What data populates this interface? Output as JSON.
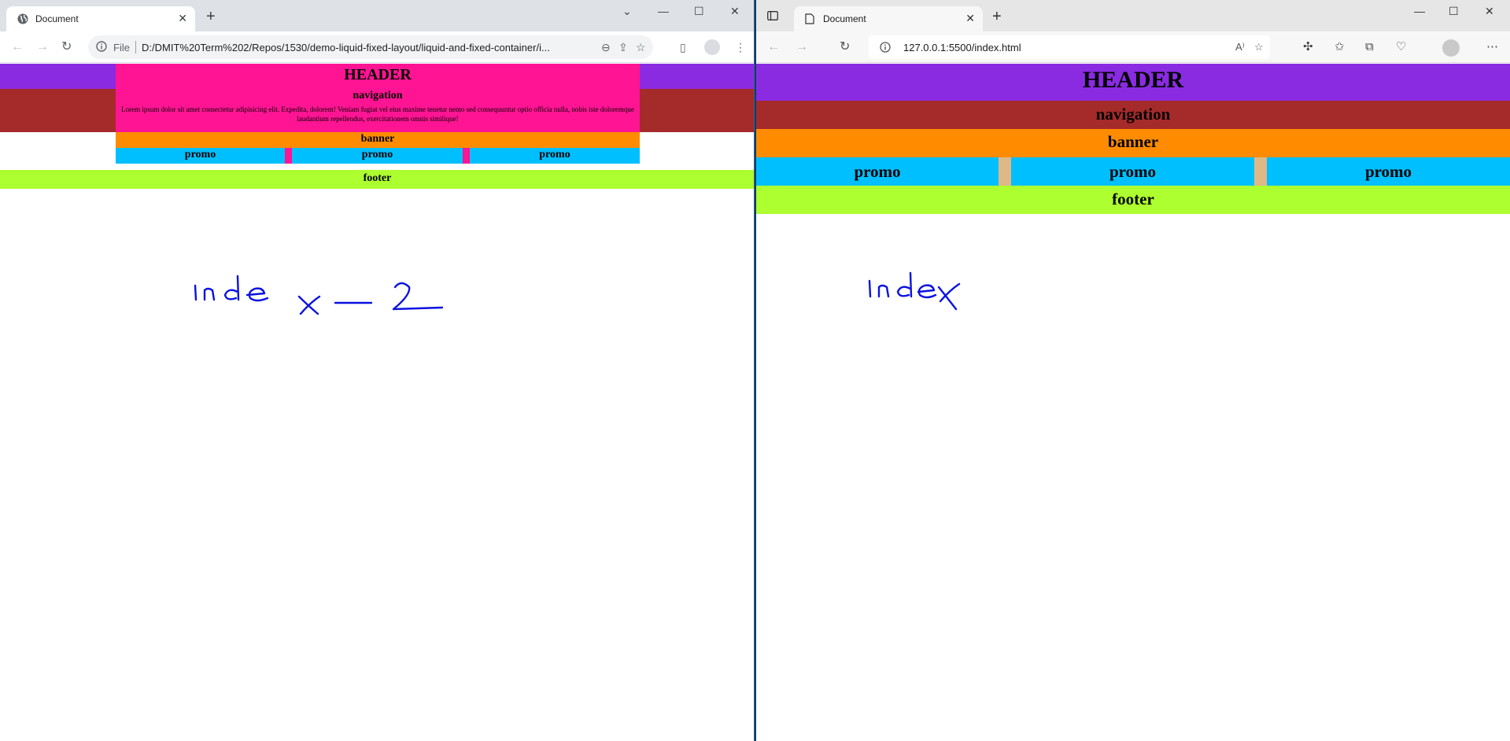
{
  "colors": {
    "header_bg": "#8a2be2",
    "nav_bg": "#a52a2a",
    "header_box_fixed": "#ff1493",
    "banner_bg": "#ff8c00",
    "promo_bg": "#00bfff",
    "promo_gap_fixed": "#ff1493",
    "promo_gap_liquid": "#deb887",
    "footer_bg": "#adff2f",
    "ink": "#0b12e0"
  },
  "chrome": {
    "tab_title": "Document",
    "address_scheme": "File",
    "address_url": "D:/DMIT%20Term%202/Repos/1530/demo-liquid-fixed-layout/liquid-and-fixed-container/i...",
    "page": {
      "header": "HEADER",
      "navigation": "navigation",
      "lorem": "Lorem ipsum dolor sit amet consectetur adipisicing elit. Expedita, dolorem! Veniam fugiat vel eius maxime tenetur nemo sed consequuntur optio officia nulla, nobis iste doloremque laudantium repellendus, exercitationem omnis similique!",
      "banner": "banner",
      "promos": [
        "promo",
        "promo",
        "promo"
      ],
      "footer": "footer"
    },
    "annotation": "index-2"
  },
  "edge": {
    "tab_title": "Document",
    "address_url": "127.0.0.1:5500/index.html",
    "page": {
      "header": "HEADER",
      "navigation": "navigation",
      "banner": "banner",
      "promos": [
        "promo",
        "promo",
        "promo"
      ],
      "footer": "footer"
    },
    "annotation": "index"
  }
}
